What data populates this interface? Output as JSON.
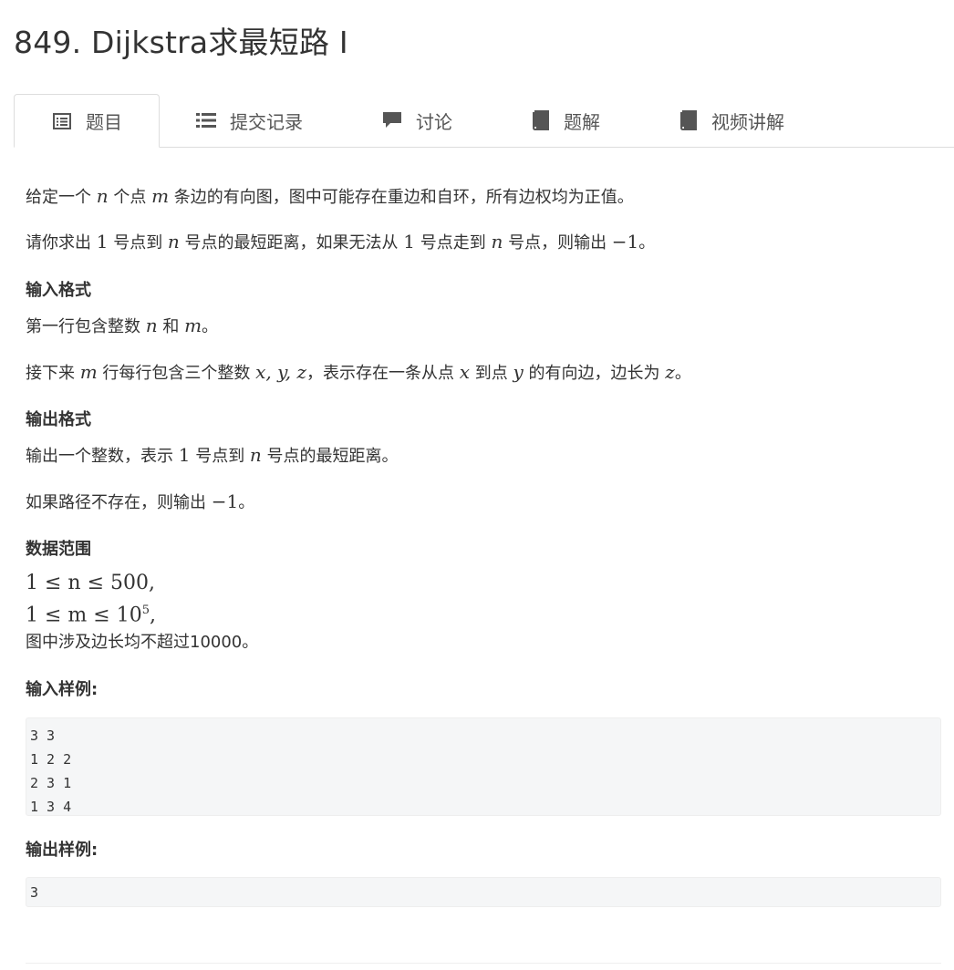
{
  "page": {
    "title": "849. Dijkstra求最短路 I"
  },
  "tabs": [
    {
      "label": "题目",
      "icon": "list-alt-icon",
      "active": true
    },
    {
      "label": "提交记录",
      "icon": "list-icon",
      "active": false
    },
    {
      "label": "讨论",
      "icon": "comment-icon",
      "active": false
    },
    {
      "label": "题解",
      "icon": "book-icon",
      "active": false
    },
    {
      "label": "视频讲解",
      "icon": "book-icon",
      "active": false
    }
  ],
  "problem": {
    "p1": {
      "a": "给定一个 ",
      "b": "n",
      "c": " 个点 ",
      "d": "m",
      "e": " 条边的有向图，图中可能存在重边和自环，所有边权均为正值。"
    },
    "p2": {
      "a": "请你求出 ",
      "b": "1",
      "c": " 号点到 ",
      "d": "n",
      "e": " 号点的最短距离，如果无法从 ",
      "f": "1",
      "g": " 号点走到 ",
      "h": "n",
      "i": " 号点，则输出 ",
      "j": "−1",
      "k": "。"
    },
    "input_heading": "输入格式",
    "in1": {
      "a": "第一行包含整数 ",
      "b": "n",
      "c": " 和 ",
      "d": "m",
      "e": "。"
    },
    "in2": {
      "a": "接下来 ",
      "b": "m",
      "c": " 行每行包含三个整数 ",
      "d": "x, y, z",
      "e": "，表示存在一条从点 ",
      "f": "x",
      "g": " 到点 ",
      "h": "y",
      "i": " 的有向边，边长为 ",
      "j": "z",
      "k": "。"
    },
    "output_heading": "输出格式",
    "out1": {
      "a": "输出一个整数，表示 ",
      "b": "1",
      "c": " 号点到 ",
      "d": "n",
      "e": " 号点的最短距离。"
    },
    "out2": {
      "a": "如果路径不存在，则输出 ",
      "b": "−1",
      "c": "。"
    },
    "range_heading": "数据范围",
    "range1": "1 ≤ n ≤ 500,",
    "range2_base": "1 ≤ m ≤ 10",
    "range2_sup": "5",
    "range2_tail": ",",
    "range3": "图中涉及边长均不超过10000。",
    "sample_in_heading": "输入样例:",
    "sample_in": [
      "3 3",
      "1 2 2",
      "2 3 1",
      "1 3 4"
    ],
    "sample_out_heading": "输出样例:",
    "sample_out": [
      "3"
    ]
  },
  "colors": {
    "text": "#333333",
    "border": "#dddddd",
    "code_bg": "#f5f6f7"
  }
}
